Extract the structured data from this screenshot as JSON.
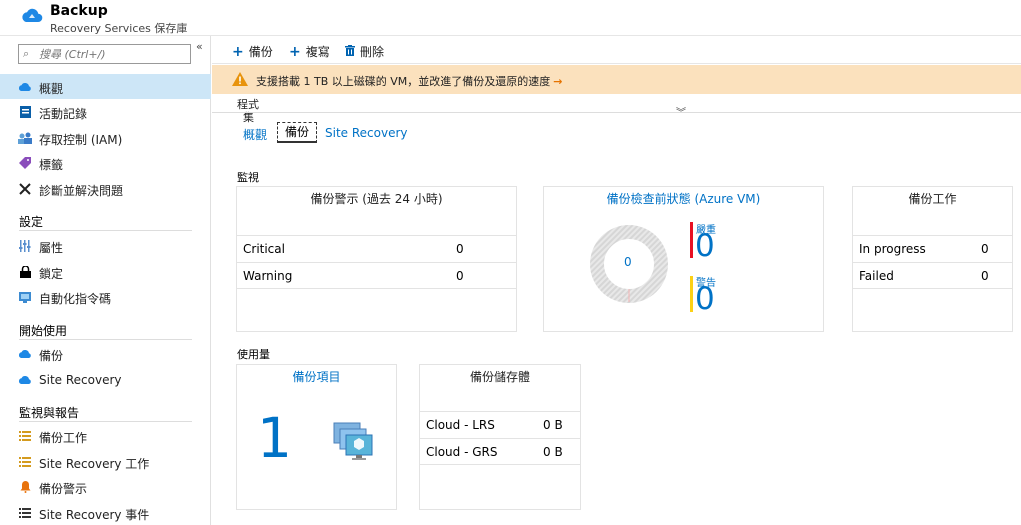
{
  "header": {
    "title": "Backup",
    "subtitle": "Recovery Services 保存庫"
  },
  "search": {
    "placeholder": "搜尋 (Ctrl+/)"
  },
  "collapse_glyph": "«",
  "nav": {
    "overview": "概觀",
    "activity_log": "活動記錄",
    "iam": "存取控制 (IAM)",
    "tags": "標籤",
    "diagnose": "診斷並解決問題",
    "section_settings": "設定",
    "properties": "屬性",
    "locks": "鎖定",
    "automation": "自動化指令碼",
    "section_getting_started": "開始使用",
    "backup": "備份",
    "site_recovery": "Site Recovery",
    "section_monitoring": "監視與報告",
    "backup_jobs": "備份工作",
    "site_recovery_jobs": "Site Recovery 工作",
    "backup_alerts": "備份警示",
    "site_recovery_events": "Site Recovery 事件"
  },
  "toolbar": {
    "backup": "備份",
    "replicate": "複寫",
    "delete": "刪除"
  },
  "banner": {
    "text": "支援搭載 1 TB 以上磁碟的 VM，並改進了備份及還原的速度"
  },
  "essentials": {
    "line1": "程式",
    "line2": "集"
  },
  "tabs": {
    "overview": "概觀",
    "backup": "備份",
    "site_recovery": "Site Recovery"
  },
  "monitoring": {
    "section": "監視",
    "alerts": {
      "title": "備份警示 (過去 24 小時)",
      "rows": [
        {
          "label": "Critical",
          "value": "0"
        },
        {
          "label": "Warning",
          "value": "0"
        }
      ]
    },
    "precheck": {
      "title": "備份檢查前狀態 (Azure VM)",
      "center": "0",
      "critical_label": "嚴重",
      "critical_value": "0",
      "warning_label": "警告",
      "warning_value": "0"
    },
    "jobs": {
      "title": "備份工作",
      "rows": [
        {
          "label": "In progress",
          "value": "0"
        },
        {
          "label": "Failed",
          "value": "0"
        }
      ]
    }
  },
  "usage": {
    "section": "使用量",
    "items": {
      "title": "備份項目",
      "count": "1"
    },
    "storage": {
      "title": "備份儲存體",
      "rows": [
        {
          "label": "Cloud - LRS",
          "value": "0 B"
        },
        {
          "label": "Cloud - GRS",
          "value": "0 B"
        }
      ]
    }
  },
  "colors": {
    "accent": "#0072c6",
    "selected": "#cde6f7",
    "banner": "#fbe1bd",
    "critical": "#e81123",
    "warning": "#fcd116"
  }
}
